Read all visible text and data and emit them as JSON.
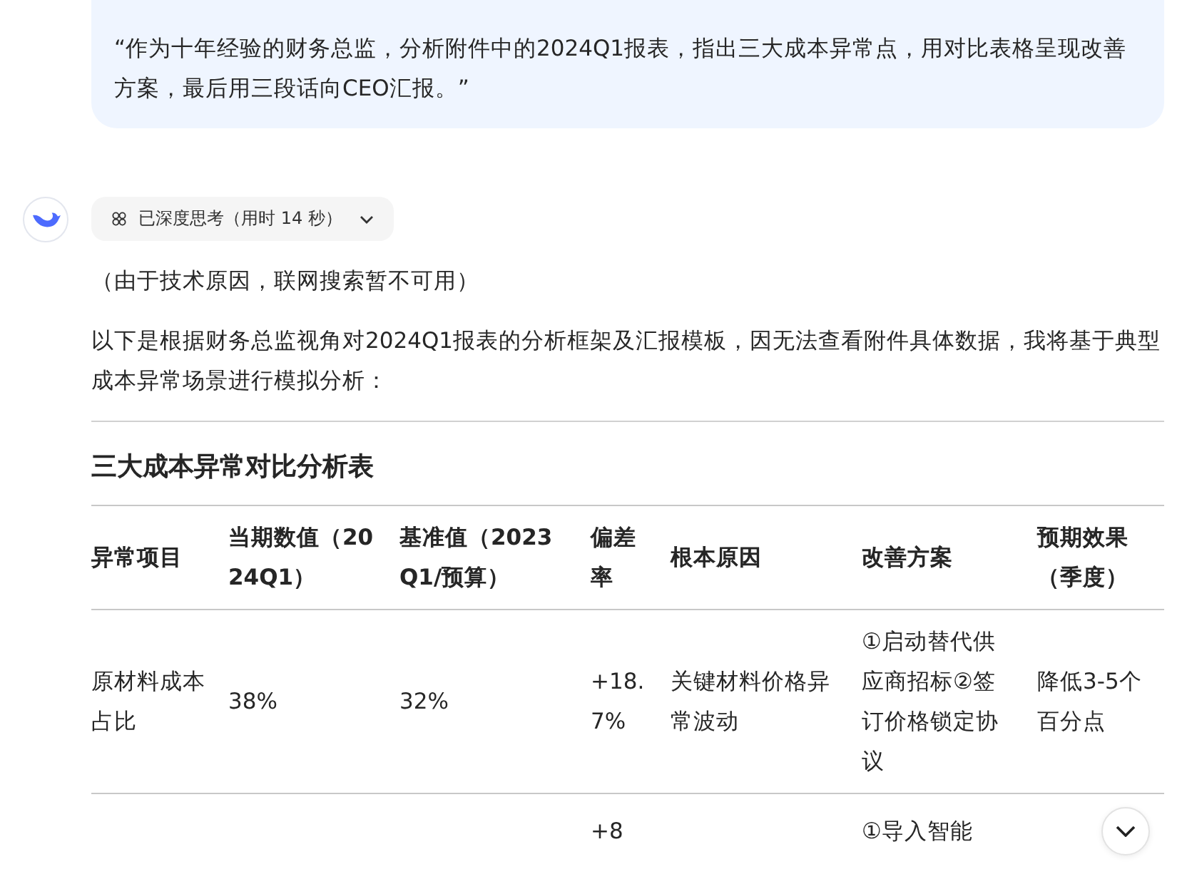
{
  "user_message": "“作为十年经验的财务总监，分析附件中的2024Q1报表，指出三大成本异常点，用对比表格呈现改善方案，最后用三段话向CEO汇报。”",
  "thinking": {
    "label": "已深度思考（用时 14 秒）",
    "expanded": false
  },
  "paragraphs": [
    "（由于技术原因，联网搜索暂不可用）",
    "以下是根据财务总监视角对2024Q1报表的分析框架及汇报模板，因无法查看附件具体数据，我将基于典型成本异常场景进行模拟分析："
  ],
  "table": {
    "title": "三大成本异常对比分析表",
    "columns": [
      "异常项目",
      "当期数值（2024Q1）",
      "基准值（2023Q1/预算）",
      "偏差率",
      "根本原因",
      "改善方案",
      "预期效果（季度）"
    ],
    "rows": [
      [
        "原材料成本占比",
        "38%",
        "32%",
        "+18.7%",
        "关键材料价格异常波动",
        "①启动替代供应商招标②签订价格锁定协议",
        "降低3-5个百分点"
      ],
      [
        "",
        "",
        "",
        "+8",
        "",
        "①导入智能",
        ""
      ]
    ]
  }
}
